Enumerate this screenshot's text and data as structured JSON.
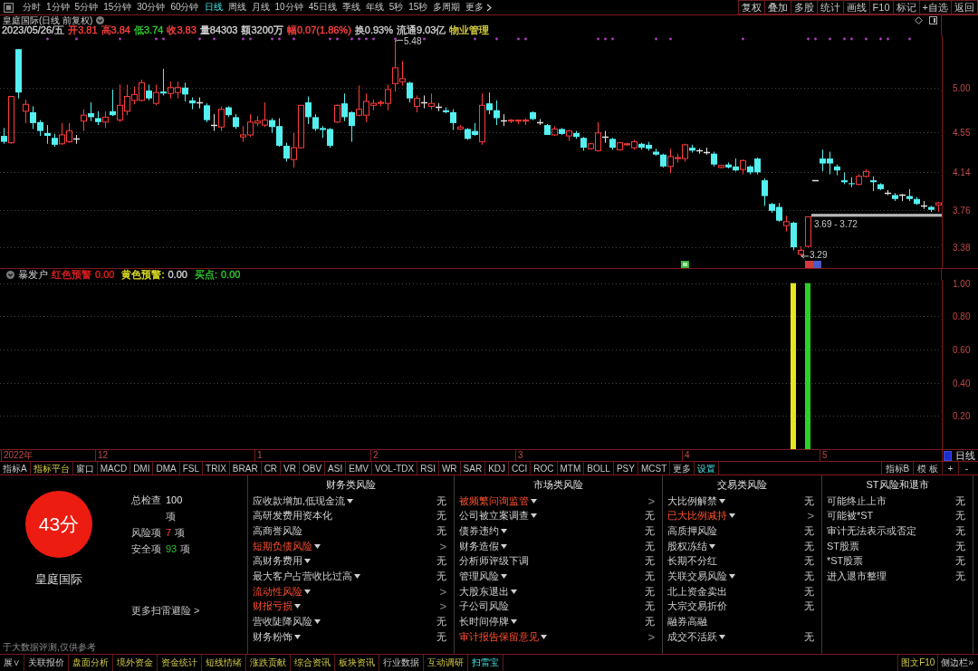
{
  "toolbar": {
    "periods": [
      {
        "label": "分时",
        "selected": false
      },
      {
        "label": "1分钟",
        "selected": false
      },
      {
        "label": "5分钟",
        "selected": false
      },
      {
        "label": "15分钟",
        "selected": false
      },
      {
        "label": "30分钟",
        "selected": false
      },
      {
        "label": "60分钟",
        "selected": false
      },
      {
        "label": "日线",
        "selected": true
      },
      {
        "label": "周线",
        "selected": false
      },
      {
        "label": "月线",
        "selected": false
      },
      {
        "label": "10分钟",
        "selected": false
      },
      {
        "label": "45日线",
        "selected": false
      },
      {
        "label": "季线",
        "selected": false
      },
      {
        "label": "年线",
        "selected": false
      },
      {
        "label": "5秒",
        "selected": false
      },
      {
        "label": "15秒",
        "selected": false
      },
      {
        "label": "多周期",
        "selected": false
      }
    ],
    "more": "更多",
    "buttons": [
      "复权",
      "叠加",
      "多股",
      "统计",
      "画线",
      "F10",
      "标记",
      "+自选",
      "返回"
    ]
  },
  "stock": {
    "title": "皇庭国际(日线 前复权)",
    "quote": [
      {
        "text": "2023/05/26/五",
        "color": "#d2d2d2"
      },
      {
        "text": "开3.81",
        "color": "#ff4040"
      },
      {
        "text": "高3.84",
        "color": "#ff4040"
      },
      {
        "text": "低3.74",
        "color": "#30d030"
      },
      {
        "text": "收3.83",
        "color": "#ff4040"
      },
      {
        "text": "量84303",
        "color": "#d2d2d2"
      },
      {
        "text": "额3200万",
        "color": "#d2d2d2"
      },
      {
        "text": "幅0.07(1.86%)",
        "color": "#ff4040"
      },
      {
        "text": "换0.93%",
        "color": "#d2d2d2"
      },
      {
        "text": "流通9.03亿",
        "color": "#d2d2d2"
      },
      {
        "text": "物业管理",
        "color": "#d8d040"
      }
    ]
  },
  "price_chart": {
    "chart_data": [
      {
        "type": "candlestick",
        "ylim": [
          3.17,
          5.53
        ],
        "yticks": [
          {
            "value": 3.38,
            "label": "3.38"
          },
          {
            "value": 3.76,
            "label": "3.76"
          },
          {
            "value": 4.14,
            "label": "4.14"
          },
          {
            "value": 4.55,
            "label": "4.55"
          },
          {
            "value": 5.0,
            "label": "5.00"
          }
        ],
        "grid": true,
        "ohlc": [
          [
            4.51,
            4.59,
            4.43,
            4.45
          ],
          [
            4.44,
            4.91,
            4.43,
            4.91
          ],
          [
            5.39,
            5.39,
            4.89,
            4.95
          ],
          [
            4.76,
            4.88,
            4.64,
            4.83
          ],
          [
            4.75,
            4.81,
            4.58,
            4.64
          ],
          [
            4.65,
            4.67,
            4.51,
            4.56
          ],
          [
            4.54,
            4.62,
            4.43,
            4.51
          ],
          [
            4.49,
            4.53,
            4.4,
            4.42
          ],
          [
            4.43,
            4.64,
            4.42,
            4.52
          ],
          [
            4.45,
            4.64,
            4.44,
            4.56
          ],
          [
            4.48,
            4.52,
            4.43,
            4.48
          ],
          [
            4.66,
            4.78,
            4.56,
            4.72
          ],
          [
            4.74,
            4.85,
            4.66,
            4.7
          ],
          [
            4.69,
            4.76,
            4.62,
            4.65
          ],
          [
            4.65,
            4.76,
            4.59,
            4.7
          ],
          [
            4.76,
            4.98,
            4.71,
            4.72
          ],
          [
            4.67,
            5.03,
            4.65,
            4.82
          ],
          [
            4.76,
            5.03,
            4.72,
            4.91
          ],
          [
            4.87,
            5.01,
            4.83,
            4.93
          ],
          [
            4.87,
            5.08,
            4.86,
            5.05
          ],
          [
            4.97,
            5.03,
            4.87,
            4.89
          ],
          [
            4.84,
            5.03,
            4.82,
            4.95
          ],
          [
            4.96,
            5.19,
            4.92,
            4.94
          ],
          [
            4.94,
            5.06,
            4.89,
            5.0
          ],
          [
            4.95,
            5.06,
            4.89,
            5.0
          ],
          [
            5.0,
            5.05,
            4.86,
            4.93
          ],
          [
            4.87,
            4.9,
            4.78,
            4.84
          ],
          [
            4.85,
            4.9,
            4.79,
            4.85
          ],
          [
            4.82,
            4.84,
            4.65,
            4.67
          ],
          [
            4.62,
            4.73,
            4.56,
            4.62
          ],
          [
            4.6,
            4.81,
            4.56,
            4.78
          ],
          [
            4.8,
            4.81,
            4.7,
            4.72
          ],
          [
            4.7,
            4.73,
            4.58,
            4.6
          ],
          [
            4.5,
            4.61,
            4.45,
            4.52
          ],
          [
            4.52,
            4.73,
            4.5,
            4.65
          ],
          [
            4.64,
            4.71,
            4.61,
            4.66
          ],
          [
            4.62,
            4.85,
            4.6,
            4.67
          ],
          [
            4.67,
            4.69,
            4.54,
            4.6
          ],
          [
            4.61,
            4.69,
            4.4,
            4.41
          ],
          [
            4.41,
            4.44,
            4.25,
            4.28
          ],
          [
            4.27,
            4.54,
            4.19,
            4.39
          ],
          [
            4.39,
            4.82,
            4.38,
            4.82
          ],
          [
            4.85,
            4.91,
            4.63,
            4.7
          ],
          [
            4.7,
            4.73,
            4.56,
            4.58
          ],
          [
            4.59,
            4.61,
            4.49,
            4.57
          ],
          [
            4.58,
            4.59,
            4.39,
            4.41
          ],
          [
            4.65,
            4.83,
            4.64,
            4.82
          ],
          [
            4.84,
            4.94,
            4.66,
            4.7
          ],
          [
            4.75,
            4.76,
            4.45,
            4.61
          ],
          [
            4.72,
            5.02,
            4.71,
            4.78
          ],
          [
            4.72,
            4.94,
            4.65,
            4.86
          ],
          [
            4.82,
            4.88,
            4.77,
            4.84
          ],
          [
            4.84,
            4.87,
            4.81,
            4.85
          ],
          [
            4.84,
            5.03,
            4.77,
            4.98
          ],
          [
            5.04,
            5.48,
            4.96,
            5.2
          ],
          [
            5.06,
            5.27,
            5.02,
            5.09
          ],
          [
            5.05,
            5.06,
            4.85,
            4.89
          ],
          [
            4.81,
            4.92,
            4.75,
            4.89
          ],
          [
            4.85,
            4.92,
            4.79,
            4.85
          ],
          [
            4.81,
            4.94,
            4.78,
            4.84
          ],
          [
            4.8,
            4.84,
            4.76,
            4.8
          ],
          [
            4.77,
            4.8,
            4.74,
            4.75
          ],
          [
            4.75,
            4.78,
            4.57,
            4.64
          ],
          [
            4.58,
            4.62,
            4.57,
            4.6
          ],
          [
            4.58,
            4.59,
            4.47,
            4.48
          ],
          [
            4.56,
            4.64,
            4.51,
            4.52
          ],
          [
            4.45,
            4.94,
            4.42,
            4.82
          ],
          [
            4.84,
            4.95,
            4.73,
            4.77
          ],
          [
            4.77,
            4.87,
            4.62,
            4.69
          ],
          [
            4.67,
            4.73,
            4.61,
            4.67
          ],
          [
            4.66,
            4.68,
            4.64,
            4.67
          ],
          [
            4.66,
            4.67,
            4.63,
            4.67
          ],
          [
            4.66,
            4.69,
            4.62,
            4.67
          ],
          [
            4.75,
            4.76,
            4.67,
            4.68
          ],
          [
            4.65,
            4.68,
            4.62,
            4.65
          ],
          [
            4.62,
            4.63,
            4.52,
            4.52
          ],
          [
            4.52,
            4.61,
            4.51,
            4.58
          ],
          [
            4.58,
            4.59,
            4.52,
            4.53
          ],
          [
            4.51,
            4.57,
            4.46,
            4.56
          ],
          [
            4.54,
            4.56,
            4.48,
            4.5
          ],
          [
            4.49,
            4.5,
            4.36,
            4.39
          ],
          [
            4.38,
            4.44,
            4.37,
            4.43
          ],
          [
            4.36,
            4.65,
            4.35,
            4.54
          ],
          [
            4.5,
            4.56,
            4.44,
            4.5
          ],
          [
            4.48,
            4.49,
            4.37,
            4.39
          ],
          [
            4.37,
            4.45,
            4.36,
            4.44
          ],
          [
            4.42,
            4.44,
            4.41,
            4.43
          ],
          [
            4.39,
            4.47,
            4.37,
            4.45
          ],
          [
            4.43,
            4.44,
            4.37,
            4.39
          ],
          [
            4.42,
            4.45,
            4.36,
            4.38
          ],
          [
            4.35,
            4.38,
            4.31,
            4.32
          ],
          [
            4.32,
            4.33,
            4.19,
            4.2
          ],
          [
            4.2,
            4.38,
            4.13,
            4.3
          ],
          [
            4.28,
            4.33,
            4.24,
            4.29
          ],
          [
            4.28,
            4.43,
            4.25,
            4.42
          ],
          [
            4.39,
            4.42,
            4.34,
            4.36
          ],
          [
            4.36,
            4.38,
            4.33,
            4.36
          ],
          [
            4.35,
            4.39,
            4.32,
            4.35
          ],
          [
            4.33,
            4.35,
            4.2,
            4.22
          ],
          [
            4.19,
            4.22,
            4.18,
            4.21
          ],
          [
            4.22,
            4.24,
            4.18,
            4.19
          ],
          [
            4.2,
            4.28,
            4.15,
            4.16
          ],
          [
            4.17,
            4.27,
            4.12,
            4.26
          ],
          [
            4.2,
            4.21,
            4.12,
            4.14
          ],
          [
            4.28,
            4.29,
            4.12,
            4.14
          ],
          [
            4.06,
            4.08,
            3.8,
            3.9
          ],
          [
            3.82,
            3.83,
            3.73,
            3.75
          ],
          [
            3.79,
            3.83,
            3.64,
            3.65
          ],
          [
            3.6,
            3.7,
            3.54,
            3.64
          ],
          [
            3.63,
            3.64,
            3.35,
            3.38
          ],
          [
            3.31,
            3.39,
            3.29,
            3.35
          ],
          [
            3.39,
            3.69,
            3.38,
            3.69
          ],
          [
            4.06,
            4.06,
            4.06,
            4.06
          ],
          [
            4.28,
            4.37,
            4.15,
            4.23
          ],
          [
            4.28,
            4.35,
            4.12,
            4.23
          ],
          [
            4.2,
            4.22,
            4.11,
            4.16
          ],
          [
            4.06,
            4.14,
            4.02,
            4.04
          ],
          [
            4.03,
            4.09,
            3.99,
            4.02
          ],
          [
            4.02,
            4.12,
            4.01,
            4.1
          ],
          [
            4.1,
            4.17,
            4.09,
            4.15
          ],
          [
            4.06,
            4.1,
            3.95,
            4.04
          ],
          [
            4.02,
            4.03,
            3.96,
            3.97
          ],
          [
            3.93,
            3.96,
            3.91,
            3.93
          ],
          [
            3.91,
            3.93,
            3.85,
            3.87
          ],
          [
            3.91,
            3.92,
            3.85,
            3.91
          ],
          [
            3.9,
            3.97,
            3.85,
            3.87
          ],
          [
            3.87,
            3.89,
            3.81,
            3.82
          ],
          [
            3.8,
            3.85,
            3.77,
            3.8
          ],
          [
            3.79,
            3.8,
            3.74,
            3.76
          ],
          [
            3.81,
            3.84,
            3.74,
            3.83
          ]
        ],
        "annotations": [
          "5.48",
          "3.29"
        ],
        "bands": [
          {
            "axis": "y",
            "from": 3.69,
            "to": 3.72,
            "label": "3.69 - 3.72",
            "color": "#b4b4b4"
          }
        ]
      }
    ]
  },
  "indicator": {
    "name": "暴发户",
    "legend": [
      {
        "label": "红色预警",
        "color": "#e02020",
        "reading": {
          "text": "0.00",
          "color": "#e02020"
        }
      },
      {
        "label": "黄色预警:",
        "color": "#e0e020",
        "reading": {
          "text": "0.00",
          "color": "#d2d2d2"
        }
      },
      {
        "label": "买点:",
        "color": "#30c830",
        "reading": {
          "text": "0.00",
          "color": "#30c830"
        }
      }
    ],
    "chart_data": [
      {
        "type": "bar",
        "ylim": [
          0,
          1.02
        ],
        "yticks": [
          {
            "value": 0.2,
            "label": "0.20"
          },
          {
            "value": 0.4,
            "label": "0.40"
          },
          {
            "value": 0.6,
            "label": "0.60"
          },
          {
            "value": 0.8,
            "label": "0.80"
          },
          {
            "value": 1.0,
            "label": "1.00"
          }
        ],
        "grid": true,
        "categories": [
          "2022年",
          null,
          null,
          null,
          null,
          null,
          null,
          null,
          null,
          null,
          null,
          null,
          null,
          "12",
          null,
          null,
          null,
          null,
          null,
          null,
          null,
          null,
          null,
          null,
          null,
          null,
          null,
          null,
          null,
          null,
          null,
          null,
          null,
          null,
          null,
          "1",
          null,
          null,
          null,
          null,
          null,
          null,
          null,
          null,
          null,
          null,
          null,
          null,
          null,
          null,
          null,
          "2",
          null,
          null,
          null,
          null,
          null,
          null,
          null,
          null,
          null,
          null,
          null,
          null,
          null,
          null,
          null,
          null,
          null,
          null,
          null,
          "3",
          null,
          null,
          null,
          null,
          null,
          null,
          null,
          null,
          null,
          null,
          null,
          null,
          null,
          null,
          null,
          null,
          null,
          null,
          null,
          null,
          null,
          null,
          "4",
          null,
          null,
          null,
          null,
          null,
          null,
          null,
          null,
          null,
          null,
          null,
          null,
          null,
          null,
          null,
          null,
          null,
          null,
          "5",
          null,
          null,
          null,
          null,
          null,
          null,
          null,
          null,
          null,
          null,
          null,
          null,
          null,
          null,
          null,
          null
        ],
        "series": [
          {
            "color": "#e6e61e",
            "values": [
              0,
              0,
              0,
              0,
              0,
              0,
              0,
              0,
              0,
              0,
              0,
              0,
              0,
              0,
              0,
              0,
              0,
              0,
              0,
              0,
              0,
              0,
              0,
              0,
              0,
              0,
              0,
              0,
              0,
              0,
              0,
              0,
              0,
              0,
              0,
              0,
              0,
              0,
              0,
              0,
              0,
              0,
              0,
              0,
              0,
              0,
              0,
              0,
              0,
              0,
              0,
              0,
              0,
              0,
              0,
              0,
              0,
              0,
              0,
              0,
              0,
              0,
              0,
              0,
              0,
              0,
              0,
              0,
              0,
              0,
              0,
              0,
              0,
              0,
              0,
              0,
              0,
              0,
              0,
              0,
              0,
              0,
              0,
              0,
              0,
              0,
              0,
              0,
              0,
              0,
              0,
              0,
              0,
              0,
              0,
              0,
              0,
              0,
              0,
              0,
              0,
              0,
              0,
              0,
              0,
              0,
              0,
              0,
              0,
              1,
              0,
              0,
              0,
              0,
              0,
              0,
              0,
              0,
              0,
              0,
              0,
              0,
              0,
              0,
              0,
              0,
              0,
              0,
              0,
              0
            ]
          },
          {
            "color": "#28d228",
            "values": [
              0,
              0,
              0,
              0,
              0,
              0,
              0,
              0,
              0,
              0,
              0,
              0,
              0,
              0,
              0,
              0,
              0,
              0,
              0,
              0,
              0,
              0,
              0,
              0,
              0,
              0,
              0,
              0,
              0,
              0,
              0,
              0,
              0,
              0,
              0,
              0,
              0,
              0,
              0,
              0,
              0,
              0,
              0,
              0,
              0,
              0,
              0,
              0,
              0,
              0,
              0,
              0,
              0,
              0,
              0,
              0,
              0,
              0,
              0,
              0,
              0,
              0,
              0,
              0,
              0,
              0,
              0,
              0,
              0,
              0,
              0,
              0,
              0,
              0,
              0,
              0,
              0,
              0,
              0,
              0,
              0,
              0,
              0,
              0,
              0,
              0,
              0,
              0,
              0,
              0,
              0,
              0,
              0,
              0,
              0,
              0,
              0,
              0,
              0,
              0,
              0,
              0,
              0,
              0,
              0,
              0,
              0,
              0,
              0,
              0,
              0,
              1,
              0,
              0,
              0,
              0,
              0,
              0,
              0,
              0,
              0,
              0,
              0,
              0,
              0,
              0,
              0,
              0,
              0,
              0
            ]
          }
        ]
      }
    ],
    "period": "日线"
  },
  "indicator_tabs": [
    {
      "label": "指标A",
      "highlighted": false,
      "selected": false
    },
    {
      "label": "指标平台",
      "highlighted": true,
      "selected": false
    },
    {
      "label": "窗口",
      "highlighted": false,
      "selected": false
    },
    {
      "label": "MACD",
      "highlighted": false,
      "selected": false
    },
    {
      "label": "DMI",
      "highlighted": false,
      "selected": false
    },
    {
      "label": "DMA",
      "highlighted": false,
      "selected": false
    },
    {
      "label": "FSL",
      "highlighted": false,
      "selected": false
    },
    {
      "label": "TRIX",
      "highlighted": false,
      "selected": false
    },
    {
      "label": "BRAR",
      "highlighted": false,
      "selected": false
    },
    {
      "label": "CR",
      "highlighted": false,
      "selected": false
    },
    {
      "label": "VR",
      "highlighted": false,
      "selected": false
    },
    {
      "label": "OBV",
      "highlighted": false,
      "selected": false
    },
    {
      "label": "ASI",
      "highlighted": false,
      "selected": false
    },
    {
      "label": "EMV",
      "highlighted": false,
      "selected": false
    },
    {
      "label": "VOL-TDX",
      "highlighted": false,
      "selected": false
    },
    {
      "label": "RSI",
      "highlighted": false,
      "selected": false
    },
    {
      "label": "WR",
      "highlighted": false,
      "selected": false
    },
    {
      "label": "SAR",
      "highlighted": false,
      "selected": false
    },
    {
      "label": "KDJ",
      "highlighted": false,
      "selected": false
    },
    {
      "label": "CCI",
      "highlighted": false,
      "selected": false
    },
    {
      "label": "ROC",
      "highlighted": false,
      "selected": false
    },
    {
      "label": "MTM",
      "highlighted": false,
      "selected": false
    },
    {
      "label": "BOLL",
      "highlighted": false,
      "selected": false
    },
    {
      "label": "PSY",
      "highlighted": false,
      "selected": false
    },
    {
      "label": "MCST",
      "highlighted": false,
      "selected": false
    },
    {
      "label": "更多",
      "highlighted": false,
      "selected": false
    },
    {
      "label": "设置",
      "highlighted": false,
      "selected": true
    }
  ],
  "indicator_tools": [
    "指标B",
    "模 板",
    "+",
    "-"
  ],
  "risk_scan": {
    "score": "43分",
    "stock": "皇庭国际",
    "stats": [
      {
        "label": "总检查",
        "value": "100",
        "unit": "项",
        "kind": "total"
      },
      {
        "label": "风险项",
        "value": "7",
        "unit": "项",
        "kind": "risk"
      },
      {
        "label": "安全项",
        "value": "93",
        "unit": "项",
        "kind": "safe"
      }
    ],
    "more_link": "更多扫雷避险 >",
    "disclaimer": "于大数据评测,仅供参考",
    "groups": [
      {
        "title": "财务类风险",
        "items": [
          {
            "label": "应收款增加,低现金流",
            "expandable": true,
            "flagged": false,
            "status": "无"
          },
          {
            "label": "高研发费用资本化",
            "expandable": false,
            "flagged": false,
            "status": "无"
          },
          {
            "label": "高商誉风险",
            "expandable": false,
            "flagged": false,
            "status": "无"
          },
          {
            "label": "短期负债风险",
            "expandable": true,
            "flagged": true,
            "status": ">"
          },
          {
            "label": "高财务费用",
            "expandable": true,
            "flagged": false,
            "status": "无"
          },
          {
            "label": "最大客户占营收比过高",
            "expandable": true,
            "flagged": false,
            "status": "无"
          },
          {
            "label": "流动性风险",
            "expandable": true,
            "flagged": true,
            "status": ">"
          },
          {
            "label": "财报亏损",
            "expandable": true,
            "flagged": true,
            "status": ">"
          },
          {
            "label": "营收陡降风险",
            "expandable": true,
            "flagged": false,
            "status": "无"
          },
          {
            "label": "财务粉饰",
            "expandable": true,
            "flagged": false,
            "status": "无"
          }
        ]
      },
      {
        "title": "市场类风险",
        "items": [
          {
            "label": "被频繁问询监管",
            "expandable": true,
            "flagged": true,
            "status": ">"
          },
          {
            "label": "公司被立案调查",
            "expandable": true,
            "flagged": false,
            "status": "无"
          },
          {
            "label": "债券违约",
            "expandable": true,
            "flagged": false,
            "status": "无"
          },
          {
            "label": "财务造假",
            "expandable": true,
            "flagged": false,
            "status": "无"
          },
          {
            "label": "分析师评级下调",
            "expandable": false,
            "flagged": false,
            "status": "无"
          },
          {
            "label": "管理风险",
            "expandable": true,
            "flagged": false,
            "status": "无"
          },
          {
            "label": "大股东退出",
            "expandable": true,
            "flagged": false,
            "status": "无"
          },
          {
            "label": "子公司风险",
            "expandable": false,
            "flagged": false,
            "status": "无"
          },
          {
            "label": "长时间停牌",
            "expandable": true,
            "flagged": false,
            "status": "无"
          },
          {
            "label": "审计报告保留意见",
            "expandable": true,
            "flagged": true,
            "status": ">"
          }
        ]
      },
      {
        "title": "交易类风险",
        "items": [
          {
            "label": "大比例解禁",
            "expandable": true,
            "flagged": false,
            "status": "无"
          },
          {
            "label": "已大比例减持",
            "expandable": true,
            "flagged": true,
            "status": ">"
          },
          {
            "label": "高质押风险",
            "expandable": false,
            "flagged": false,
            "status": "无"
          },
          {
            "label": "股权冻结",
            "expandable": true,
            "flagged": false,
            "status": "无"
          },
          {
            "label": "长期不分红",
            "expandable": false,
            "flagged": false,
            "status": "无"
          },
          {
            "label": "关联交易风险",
            "expandable": true,
            "flagged": false,
            "status": "无"
          },
          {
            "label": "北上资金卖出",
            "expandable": false,
            "flagged": false,
            "status": "无"
          },
          {
            "label": "大宗交易折价",
            "expandable": false,
            "flagged": false,
            "status": "无"
          },
          {
            "label": "融券高融",
            "expandable": false,
            "flagged": false
          },
          {
            "label": "成交不活跃",
            "expandable": true,
            "flagged": false,
            "status": "无"
          }
        ]
      },
      {
        "title": "ST风险和退市",
        "items": [
          {
            "label": "可能终止上市",
            "expandable": false,
            "flagged": false,
            "status": "无"
          },
          {
            "label": "可能被*ST",
            "expandable": false,
            "flagged": false,
            "status": "无"
          },
          {
            "label": "审计无法表示或否定",
            "expandable": false,
            "flagged": false,
            "status": "无"
          },
          {
            "label": "ST股票",
            "expandable": false,
            "flagged": false,
            "status": "无"
          },
          {
            "label": "*ST股票",
            "expandable": false,
            "flagged": false,
            "status": "无"
          },
          {
            "label": "进入退市整理",
            "expandable": false,
            "flagged": false,
            "status": "无"
          }
        ]
      }
    ]
  },
  "bottom_tabs": [
    {
      "label": "展∨",
      "highlighted": false,
      "selected": false
    },
    {
      "label": "关联报价",
      "highlighted": false,
      "selected": false
    },
    {
      "label": "盘面分析",
      "highlighted": true,
      "selected": false
    },
    {
      "label": "境外资金",
      "highlighted": true,
      "selected": false
    },
    {
      "label": "资金统计",
      "highlighted": true,
      "selected": false
    },
    {
      "label": "短线情绪",
      "highlighted": true,
      "selected": false
    },
    {
      "label": "涨跌贡献",
      "highlighted": true,
      "selected": false
    },
    {
      "label": "综合资讯",
      "highlighted": true,
      "selected": false
    },
    {
      "label": "板块资讯",
      "highlighted": true,
      "selected": false
    },
    {
      "label": "行业数据",
      "highlighted": false,
      "selected": false
    },
    {
      "label": "互动调研",
      "highlighted": true,
      "selected": false
    },
    {
      "label": "扫雷宝",
      "highlighted": false,
      "selected": true
    }
  ],
  "side_buttons": [
    {
      "label": "图文F10",
      "highlighted": true
    },
    {
      "label": "侧边栏»",
      "highlighted": false
    }
  ]
}
